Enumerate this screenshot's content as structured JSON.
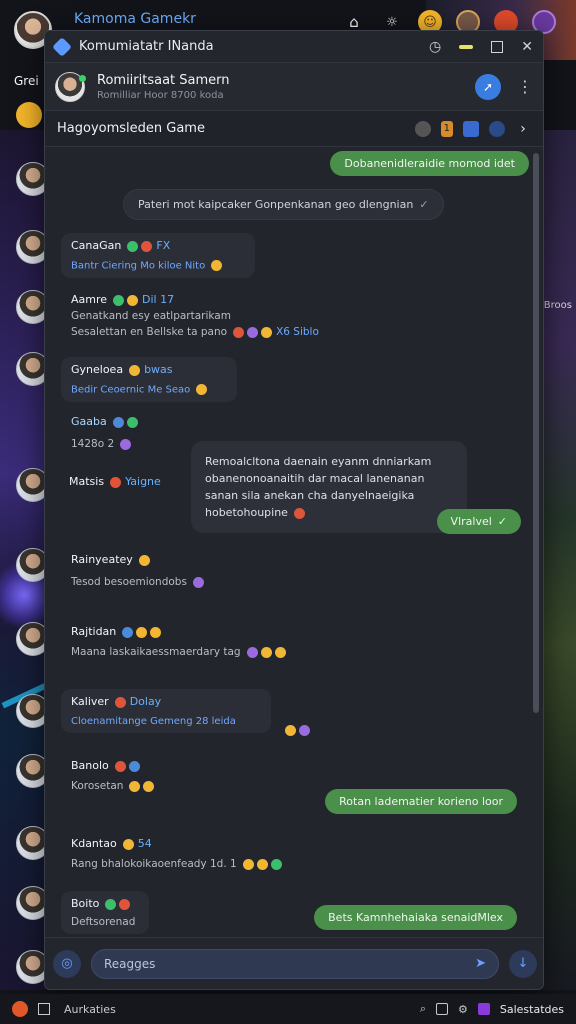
{
  "desktop": {
    "title": "Kamoma Gamekr",
    "side_label": "Grei",
    "right_label": "Broos"
  },
  "window": {
    "title": "Komumiatatr INanda"
  },
  "contact": {
    "name": "Romiiritsaat Samern",
    "status": "Romilliar Hoor 8700 koda"
  },
  "group": {
    "title": "Hagoyomsleden Game",
    "badge": "1"
  },
  "messages": {
    "out1": "Dobanenidleraidie momod idet",
    "system": "Pateri mot kaipcaker Gonpenkanan geo dlengnian",
    "m1": {
      "sender": "CanaGan",
      "tag": "FX",
      "line": "Bantr Ciering Mo kiloe Nito"
    },
    "m2": {
      "sender": "Aamre",
      "tag": "Dil 17",
      "line1": "Genatkand esy eatlpartarikam",
      "line2": "Sesalettan en Bellske ta pano",
      "extra": "X6 Siblo"
    },
    "m3": {
      "sender": "Gyneloea",
      "tag": "bwas",
      "line": "Bedir Ceoernic Me Seao"
    },
    "m4": {
      "sender": "Gaaba",
      "line": "1428o 2"
    },
    "m5": {
      "sender": "Matsis",
      "tag": "Yaigne"
    },
    "card": {
      "line1": "Remoalcltona daenain eyanm dnniarkam",
      "line2": "obanenonoanaitih dar macal lanenanan",
      "line3": "sanan sila anekan cha danyelnaeigika",
      "line4": "hobetohoupine"
    },
    "out_verified": "Vlralvel",
    "m6": {
      "sender": "Rainyeatey",
      "line": "Tesod besoemiondobs"
    },
    "m7": {
      "sender": "Rajtidan",
      "line": "Maana laskaikaessmaerdary tag"
    },
    "m8": {
      "sender": "Kaliver",
      "tag": "Dolay",
      "line": "Cloenamitange Gemeng 28 leida"
    },
    "m9": {
      "sender": "Banolo",
      "line": "Korosetan"
    },
    "out2": "Rotan ladematier korieno loor",
    "m10": {
      "sender": "Kdantao",
      "tag": "54",
      "line": "Rang bhalokoikaoenfeady 1d. 1"
    },
    "m11": {
      "sender": "Boito",
      "line": "Deftsorenad"
    },
    "out3": "Bets Kamnhehaiaka senaidMlex"
  },
  "composer": {
    "placeholder": "Reagges"
  },
  "taskbar": {
    "label": "Aurkaties",
    "right_label": "Salestatdes"
  }
}
